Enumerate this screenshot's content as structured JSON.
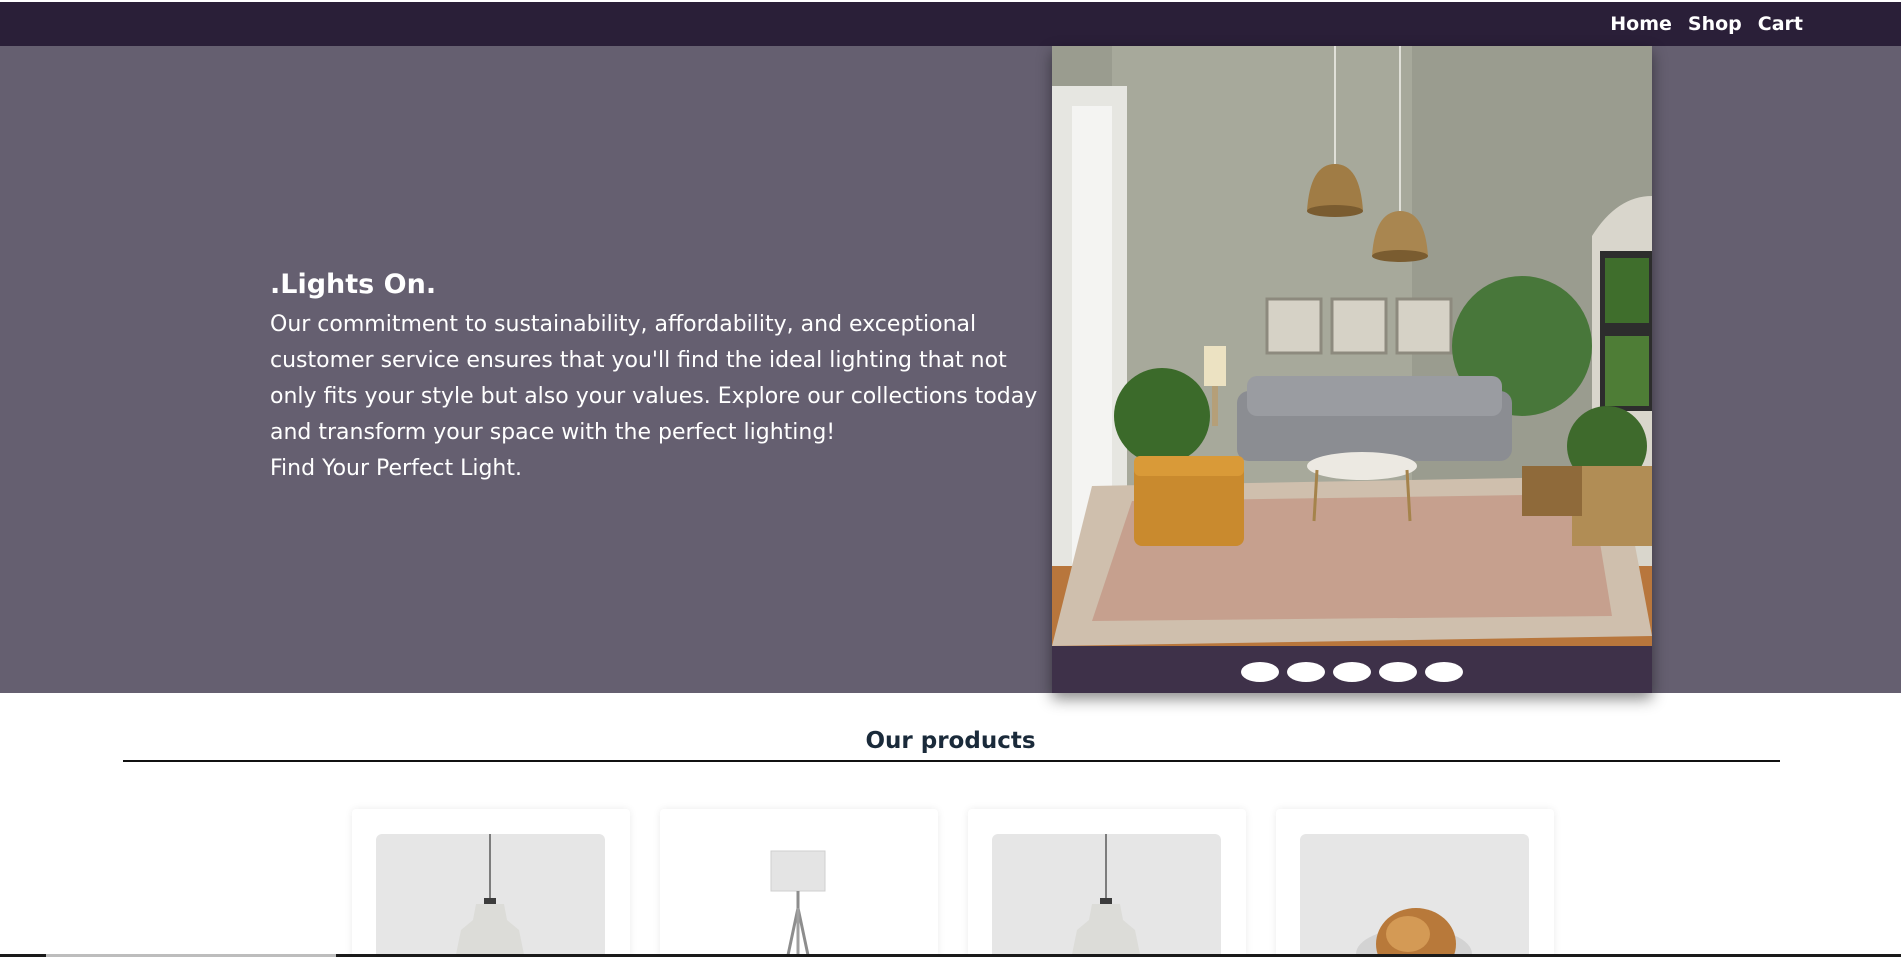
{
  "nav": {
    "links": [
      "Home",
      "Shop",
      "Cart"
    ]
  },
  "hero": {
    "title": ".Lights On.",
    "body": "Our commitment to sustainability, affordability, and exceptional customer service ensures that you'll find the ideal lighting that not only fits your style but also your values. Explore our collections today and transform your space with the perfect lighting!",
    "cta": "Find Your Perfect Light."
  },
  "slider": {
    "image_icon": "living-room-photo-icon",
    "dot_count": 5
  },
  "products": {
    "heading": "Our products",
    "items": [
      {
        "image_icon": "pendant-lamp-icon"
      },
      {
        "image_icon": "floor-lamp-icon"
      },
      {
        "image_icon": "pendant-lamp-icon"
      },
      {
        "image_icon": "amber-glass-lamp-icon"
      }
    ]
  },
  "colors": {
    "navbar": "#2a1f38",
    "hero_bg": "#655f70",
    "slider_bg": "#3e3149",
    "heading": "#1a2a3a"
  }
}
